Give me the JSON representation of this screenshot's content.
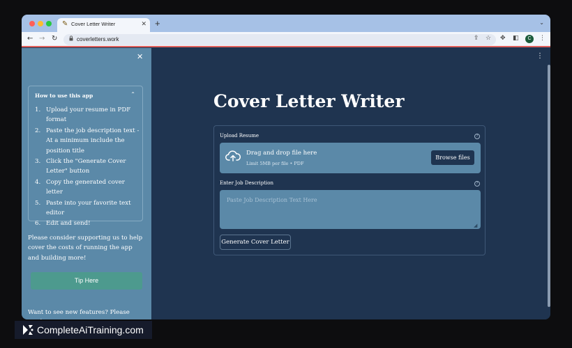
{
  "browser": {
    "tab_title": "Cover Letter Writer",
    "tab_icon": "pencil-icon",
    "url": "coverletters.work",
    "profile_initial": "C",
    "traffic_colors": [
      "#ff5f57",
      "#febc2e",
      "#28c840"
    ]
  },
  "sidebar": {
    "expander_title": "How to use this app",
    "steps": [
      {
        "num": "1.",
        "text": "Upload your resume in PDF format"
      },
      {
        "num": "2.",
        "text": "Paste the job description text - At a minimum include the position title"
      },
      {
        "num": "3.",
        "text": "Click the \"Generate Cover Letter\" button"
      },
      {
        "num": "4.",
        "text": "Copy the generated cover letter"
      },
      {
        "num": "5.",
        "text": "Paste into your favorite text editor"
      },
      {
        "num": "6.",
        "text": "Edit and send!"
      }
    ],
    "support_text": "Please consider supporting us to help cover the costs of running the app and building more!",
    "tip_button": "Tip Here",
    "features_text": "Want to see new features? Please send"
  },
  "main": {
    "title": "Cover Letter Writer",
    "upload_label": "Upload Resume",
    "dropzone_title": "Drag and drop file here",
    "dropzone_limit": "Limit 5MB per file • PDF",
    "browse_button": "Browse files",
    "job_label": "Enter Job Description",
    "job_placeholder": "Paste Job Description Text Here",
    "job_value": "",
    "generate_button": "Generate Cover Letter"
  },
  "watermark": {
    "text": "CompleteAiTraining.com"
  },
  "colors": {
    "sidebar_bg": "#5b89a8",
    "main_bg": "#1f3450",
    "tip_button": "#4d9a8e"
  }
}
